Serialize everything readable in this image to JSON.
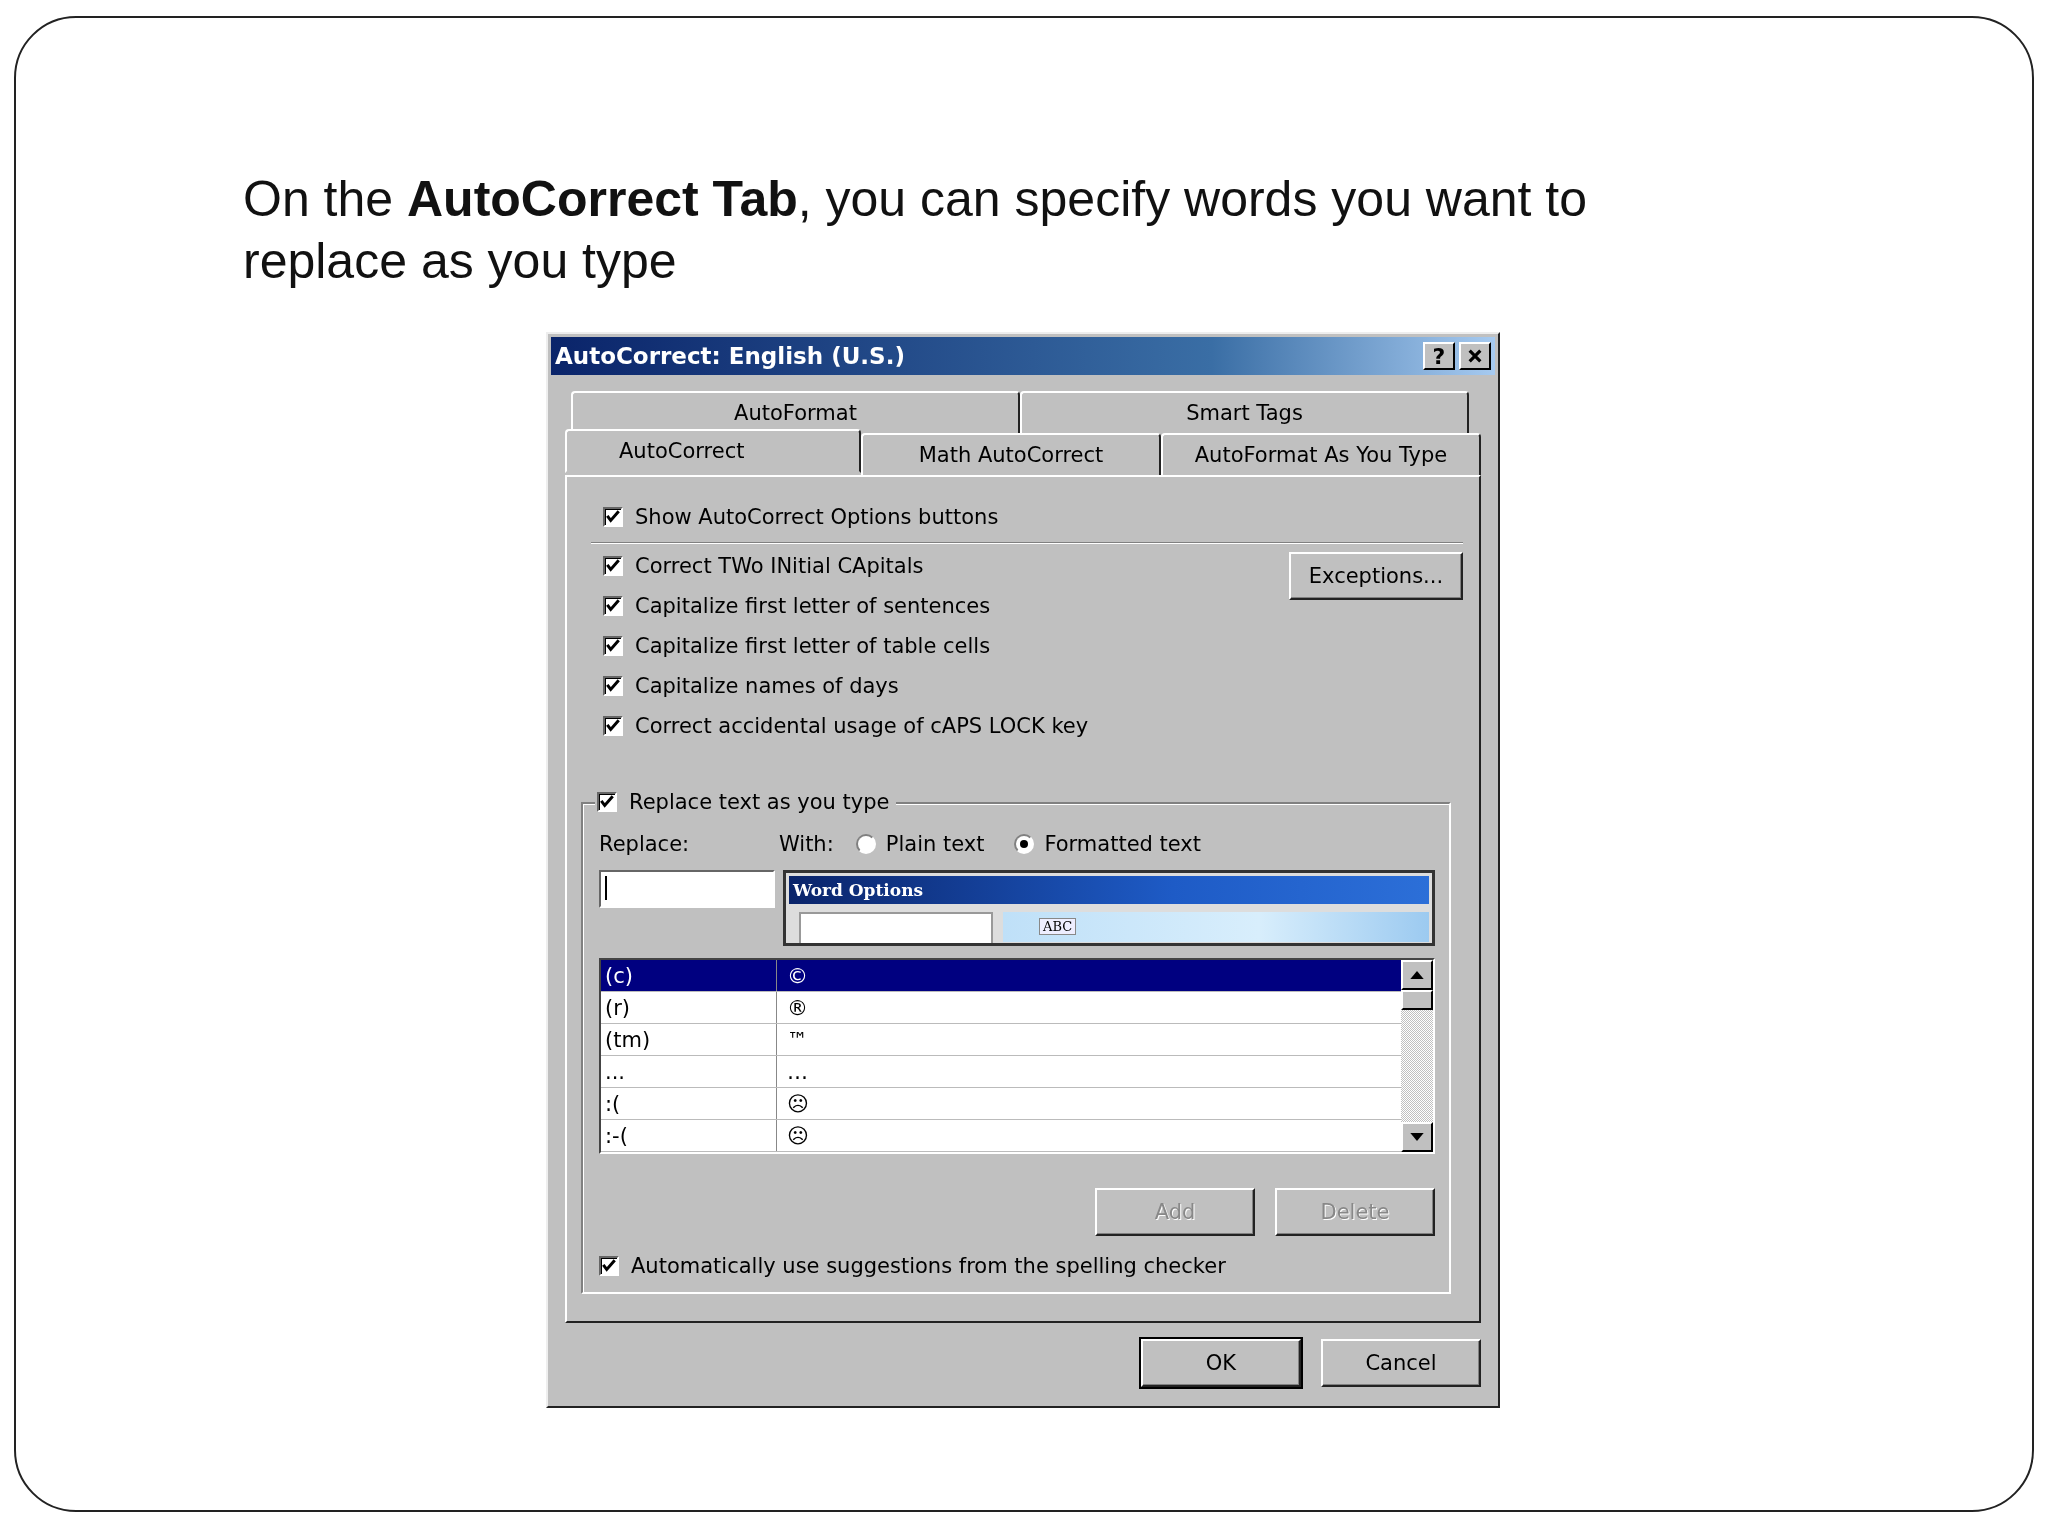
{
  "slide": {
    "heading": "On the **AutoCorrect Tab**, you can specify words you want to replace as you type"
  },
  "dialog": {
    "title": "AutoCorrect: English (U.S.)",
    "help": "?",
    "tab_rows": [
      [
        {
          "label": "AutoFormat",
          "selected": false
        },
        {
          "label": "Smart Tags",
          "selected": false
        }
      ],
      [
        {
          "label": "AutoCorrect",
          "selected": true
        },
        {
          "label": "Math AutoCorrect",
          "selected": false
        },
        {
          "label": "AutoFormat As You Type",
          "selected": false
        }
      ]
    ],
    "show_options": {
      "label": "Show AutoCorrect Options buttons",
      "checked": true
    },
    "options": [
      {
        "label": "Correct TWo INitial CApitals",
        "checked": true
      },
      {
        "label": "Capitalize first letter of sentences",
        "checked": true
      },
      {
        "label": "Capitalize first letter of table cells",
        "checked": true
      },
      {
        "label": "Capitalize names of days",
        "checked": true
      },
      {
        "label": "Correct accidental usage of cAPS LOCK key",
        "checked": true
      }
    ],
    "exceptions_button": "Exceptions...",
    "replace_group": {
      "label": "Replace text as you type",
      "checked": true,
      "replace_label": "Replace:",
      "with_label": "With:",
      "radios": [
        {
          "label": "Plain text",
          "selected": false
        },
        {
          "label": "Formatted text",
          "selected": true
        }
      ],
      "preview": {
        "title": "Word Options",
        "tag": "ABC"
      },
      "rows": [
        {
          "replace": "(c)",
          "with": "©",
          "selected": true
        },
        {
          "replace": "(r)",
          "with": "®",
          "selected": false
        },
        {
          "replace": "(tm)",
          "with": "™",
          "selected": false
        },
        {
          "replace": "...",
          "with": "…",
          "selected": false
        },
        {
          "replace": ":(",
          "with": "☹",
          "selected": false
        },
        {
          "replace": ":-(",
          "with": "☹",
          "selected": false
        }
      ],
      "buttons": [
        {
          "label": "Add",
          "disabled": true
        },
        {
          "label": "Delete",
          "disabled": true
        }
      ]
    },
    "suggestions": {
      "label": "Automatically use suggestions from the spelling checker",
      "checked": true
    },
    "buttons": [
      {
        "label": "OK",
        "default": true
      },
      {
        "label": "Cancel",
        "default": false
      }
    ]
  }
}
